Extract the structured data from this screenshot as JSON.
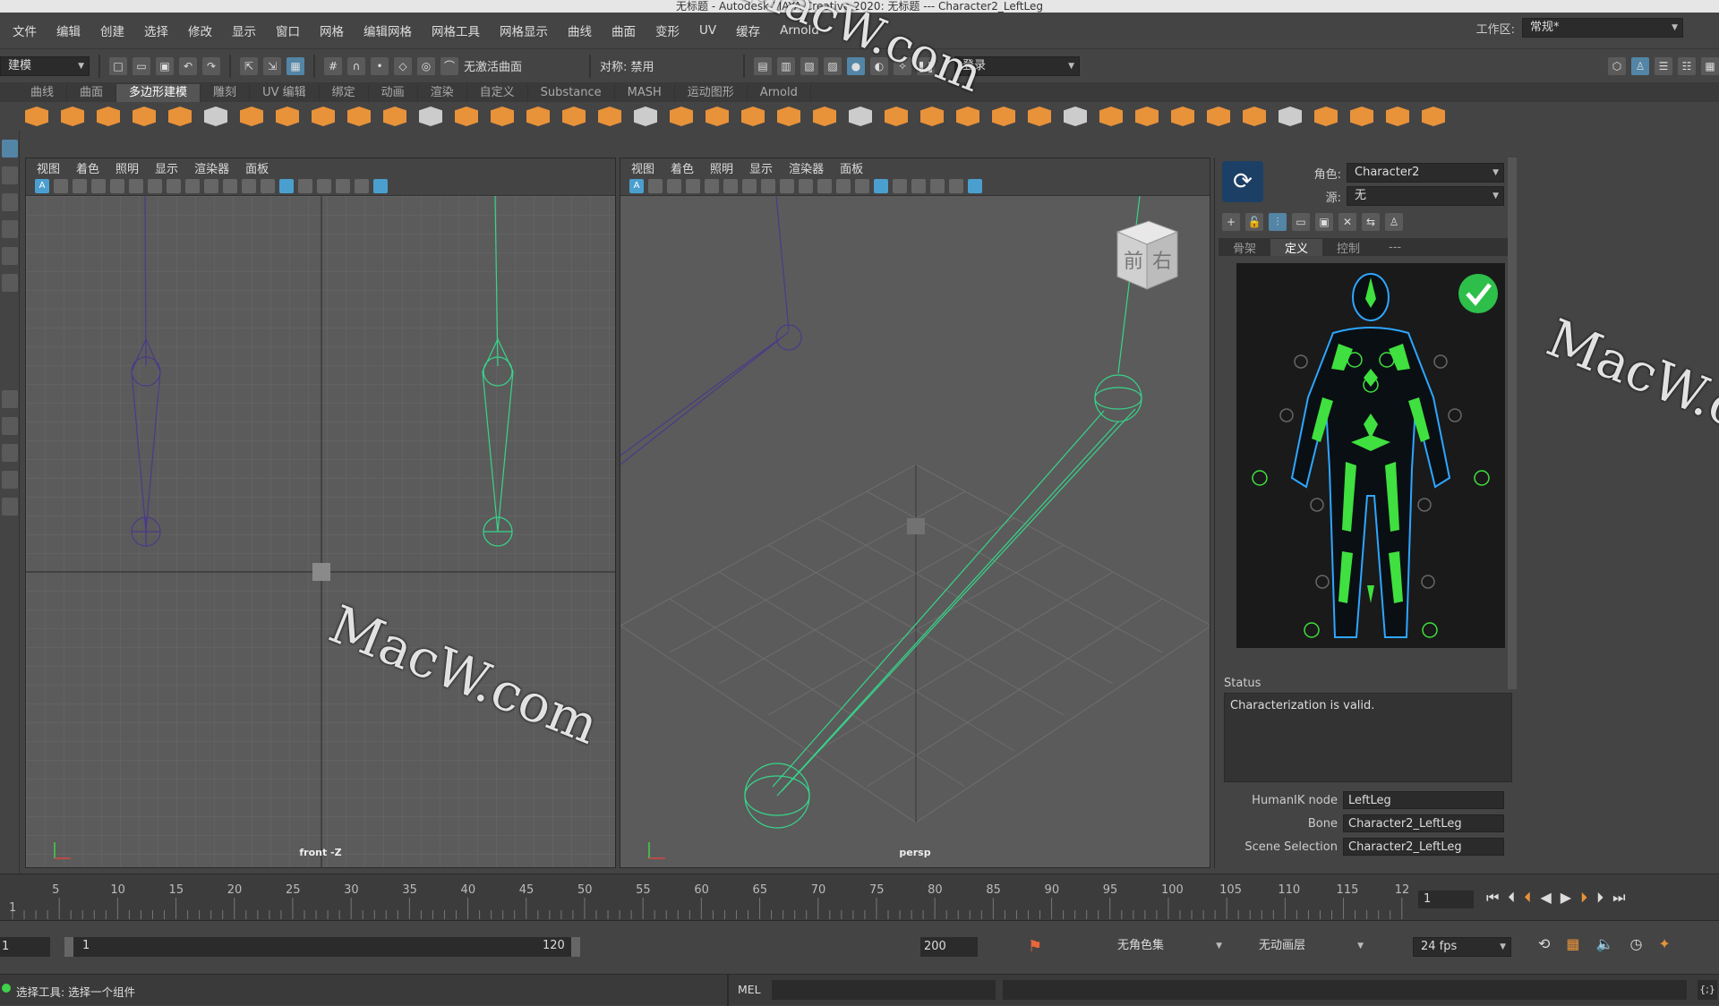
{
  "window": {
    "title": "无标题 - Autodesk MAYA Creative 2020: 无标题 --- Character2_LeftLeg"
  },
  "menu": [
    "文件",
    "编辑",
    "创建",
    "选择",
    "修改",
    "显示",
    "窗口",
    "网格",
    "编辑网格",
    "网格工具",
    "网格显示",
    "曲线",
    "曲面",
    "变形",
    "UV",
    "缓存",
    "Arnold"
  ],
  "workspace": {
    "label": "工作区:",
    "value": "常规*"
  },
  "toolbar": {
    "mode": "建模",
    "no_live": "无激活曲面",
    "symmetry": "对称: 禁用",
    "login": "登录"
  },
  "shelf_tabs": [
    "曲线",
    "曲面",
    "多边形建模",
    "雕刻",
    "UV 编辑",
    "绑定",
    "动画",
    "渲染",
    "自定义",
    "Substance",
    "MASH",
    "运动图形",
    "Arnold"
  ],
  "shelf_active": "多边形建模",
  "viewport_menu": [
    "视图",
    "着色",
    "照明",
    "显示",
    "渲染器",
    "面板"
  ],
  "viewports": {
    "left_label": "front -Z",
    "right_label": "persp",
    "cube_front": "前",
    "cube_right": "右"
  },
  "hik": {
    "character_label": "角色:",
    "character": "Character2",
    "source_label": "源:",
    "source": "无",
    "tabs": [
      "骨架",
      "定义",
      "控制",
      "---"
    ],
    "active_tab": "定义",
    "status_label": "Status",
    "status_text": "Characterization is valid.",
    "node_label": "HumanIK node",
    "node": "LeftLeg",
    "bone_label": "Bone",
    "bone": "Character2_LeftLeg",
    "scene_label": "Scene Selection",
    "scene": "Character2_LeftLeg"
  },
  "timeline": {
    "ticks": [
      "5",
      "10",
      "15",
      "20",
      "25",
      "30",
      "35",
      "40",
      "45",
      "50",
      "55",
      "60",
      "65",
      "70",
      "75",
      "80",
      "85",
      "90",
      "95",
      "100",
      "105",
      "110",
      "115",
      "12"
    ],
    "first": "1",
    "current_frame": "1"
  },
  "range": {
    "start": "1",
    "inner_start": "1",
    "inner_end": "120",
    "end": "200",
    "char_set": "无角色集",
    "anim_layer": "无动画层",
    "fps": "24 fps"
  },
  "status": {
    "help": "选择工具: 选择一个组件",
    "mel": "MEL"
  },
  "watermark": "MacW.com",
  "colors": {
    "accent": "#5285a6",
    "joint_selected": "#36d68a",
    "joint_normal": "#4b3a88",
    "hik_green": "#3fe03f"
  }
}
